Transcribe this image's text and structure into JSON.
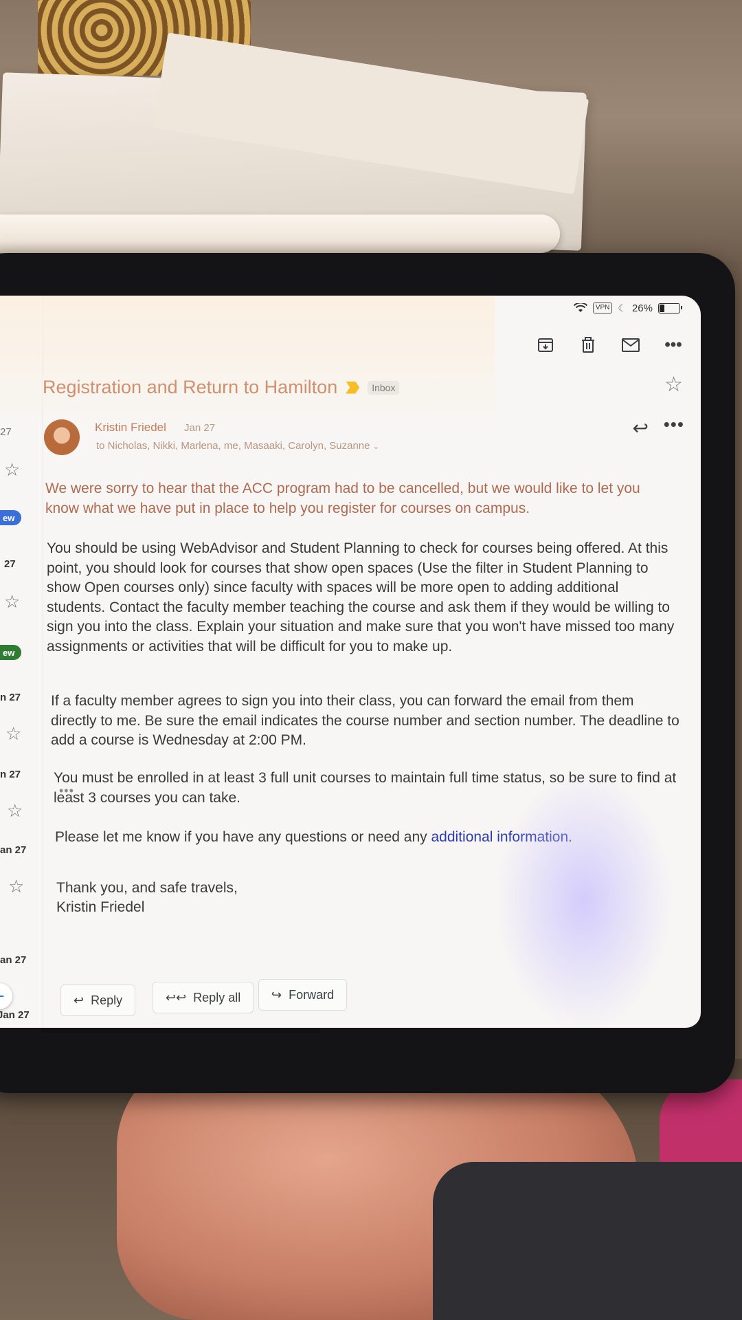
{
  "status_bar": {
    "vpn": "VPN",
    "battery": "26%",
    "battery_level": 0.26
  },
  "toolbar": {
    "archive": "archive-icon",
    "delete": "trash-icon",
    "mark_unread": "mail-icon",
    "more": "more-icon"
  },
  "list": {
    "dates": [
      "27",
      "27",
      "n 27",
      "n 27",
      "an 27",
      "an 27",
      "Jan 27"
    ],
    "pills": [
      "ew",
      "ew"
    ]
  },
  "email": {
    "subject": "Registration and Return to Hamilton",
    "label": "Inbox",
    "sender": "Kristin Friedel",
    "date": "Jan 27",
    "recipients": "to Nicholas, Nikki, Marlena, me, Masaaki, Carolyn, Suzanne",
    "paragraphs": [
      "We were sorry to hear that the ACC program had to be cancelled, but we would like to let you know what we have put in place to help you register for courses on campus.",
      "You should be using WebAdvisor and Student Planning to check for courses being offered.  At this point, you should look for courses that show open spaces (Use the filter in Student Planning to show Open courses only) since faculty with spaces will be more open to adding additional students.  Contact the faculty member teaching the course and ask them if they would be willing to sign you into the class.  Explain your situation and make sure that you won't have missed too many assignments or activities that will be difficult for you to make up.",
      "If a faculty member agrees to sign you into their class, you can forward the email from them directly to me.  Be sure the email indicates the course number and section number.  The deadline to add a course is Wednesday at 2:00 PM.",
      "You must be enrolled in at least 3 full unit courses to maintain full time status, so be sure to find at least 3 courses you can take.",
      "Please let me know if you have any questions or need any additional information.",
      "Thank you, and safe travels,",
      "Kristin Friedel"
    ],
    "trimmed": "•••"
  },
  "actions": {
    "reply": "Reply",
    "reply_all": "Reply all",
    "forward": "Forward"
  },
  "colors": {
    "accent": "#1a73e8",
    "importance": "#f4b400",
    "pill_blue": "#3b6fd8",
    "pill_green": "#2e7d32"
  }
}
